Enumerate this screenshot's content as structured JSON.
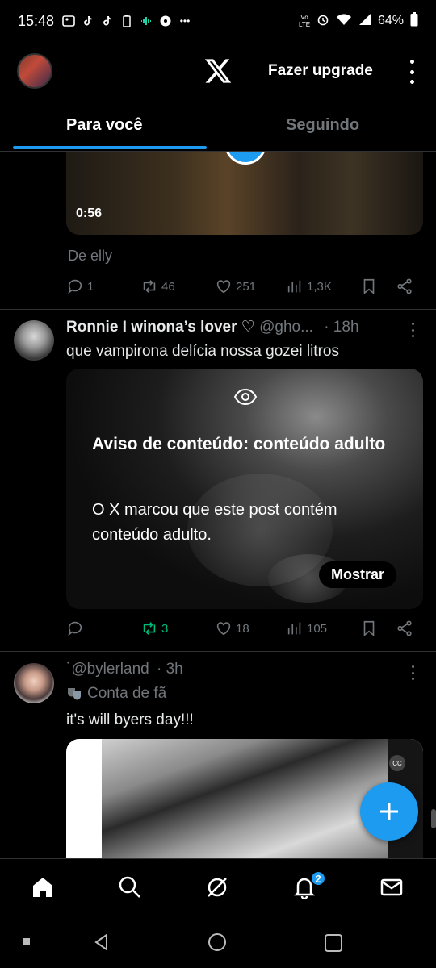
{
  "status_bar": {
    "time": "15:48",
    "battery": "64%",
    "volte": "Vo LTE",
    "overflow": "•••"
  },
  "header": {
    "upgrade_label": "Fazer upgrade"
  },
  "tabs": [
    {
      "label": "Para você",
      "active": true
    },
    {
      "label": "Seguindo",
      "active": false
    }
  ],
  "post1": {
    "video_duration": "0:56",
    "from_label": "De elly",
    "replies": "1",
    "reposts": "46",
    "likes": "251",
    "views": "1,3K"
  },
  "post2": {
    "display_name": "Ronnie I winona’s lover ♡",
    "handle": "@gho...",
    "time": "· 18h",
    "text": "que vampirona delícia nossa gozei litros",
    "warning_title": "Aviso de conteúdo: conteúdo adulto",
    "warning_desc": "O X marcou que este post contém conteúdo adulto.",
    "show_label": "Mostrar",
    "replies": "",
    "reposts": "3",
    "likes": "18",
    "views": "105",
    "repost_color": "#00ba7c"
  },
  "post3": {
    "handle": "˙@bylerland",
    "time": "· 3h",
    "badge_label": "Conta de fã",
    "text": "it's will byers day!!!",
    "cc_label": "CC"
  },
  "bottom_nav": {
    "notifications_badge": "2"
  },
  "colors": {
    "accent": "#1d9bf0",
    "secondary_text": "#71767b",
    "background": "#000000"
  }
}
